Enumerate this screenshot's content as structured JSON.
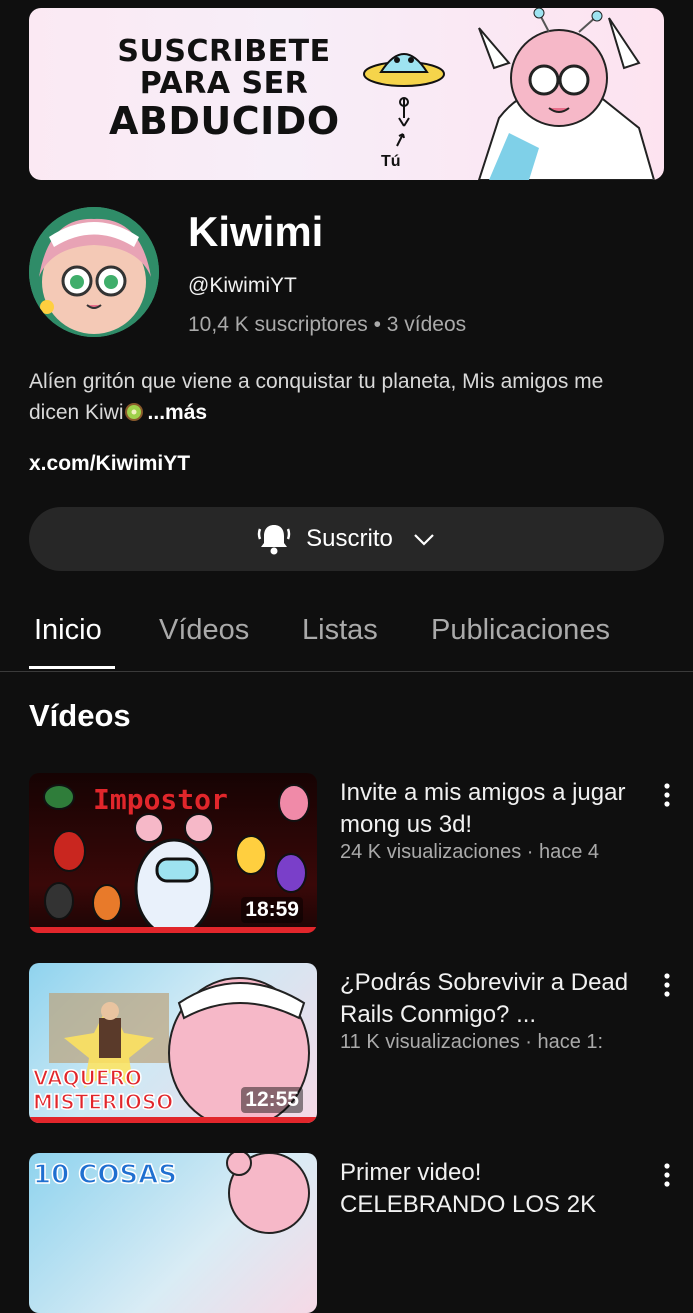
{
  "banner": {
    "line1": "SUSCRIBETE",
    "line2": "PARA SER",
    "line3": "ABDUCIDO",
    "tu_label": "Tú"
  },
  "channel": {
    "name": "Kiwimi",
    "handle": "@KiwimiYT",
    "stats": "10,4 K suscriptores • 3 vídeos",
    "description": "Alíen gritón que viene a conquistar tu planeta, Mis amigos me dicen Kiwi",
    "more_label": "...más",
    "link": "x.com/KiwimiYT",
    "subscribe_label": "Suscrito"
  },
  "tabs": [
    {
      "label": "Inicio",
      "active": true
    },
    {
      "label": "Vídeos",
      "active": false
    },
    {
      "label": "Listas",
      "active": false
    },
    {
      "label": "Publicaciones",
      "active": false
    }
  ],
  "section_title": "Vídeos",
  "videos": [
    {
      "title": "Invite a mis amigos a jugar mong us 3d!",
      "meta": "24 K visualizaciones · hace 4",
      "duration": "18:59",
      "thumb_text": "Impostor"
    },
    {
      "title": "¿Podrás Sobrevivir a Dead Rails Conmigo? ...",
      "meta": "11 K visualizaciones · hace 1:",
      "duration": "12:55",
      "thumb_text_1": "VAQUERO",
      "thumb_text_2": "MISTERIOSO"
    },
    {
      "title": "Primer video!\nCELEBRANDO LOS 2K",
      "meta": "",
      "duration": "",
      "thumb_text": "10 COSAS"
    }
  ],
  "colors": {
    "background": "#0f0f0f",
    "button_bg": "#272727",
    "secondary_text": "#aaaaaa",
    "accent_red": "#e1262b"
  },
  "icons": [
    "ufo-icon",
    "bell-icon",
    "chevron-down-icon",
    "kebab-menu-icon",
    "kiwi-emoji-icon"
  ]
}
